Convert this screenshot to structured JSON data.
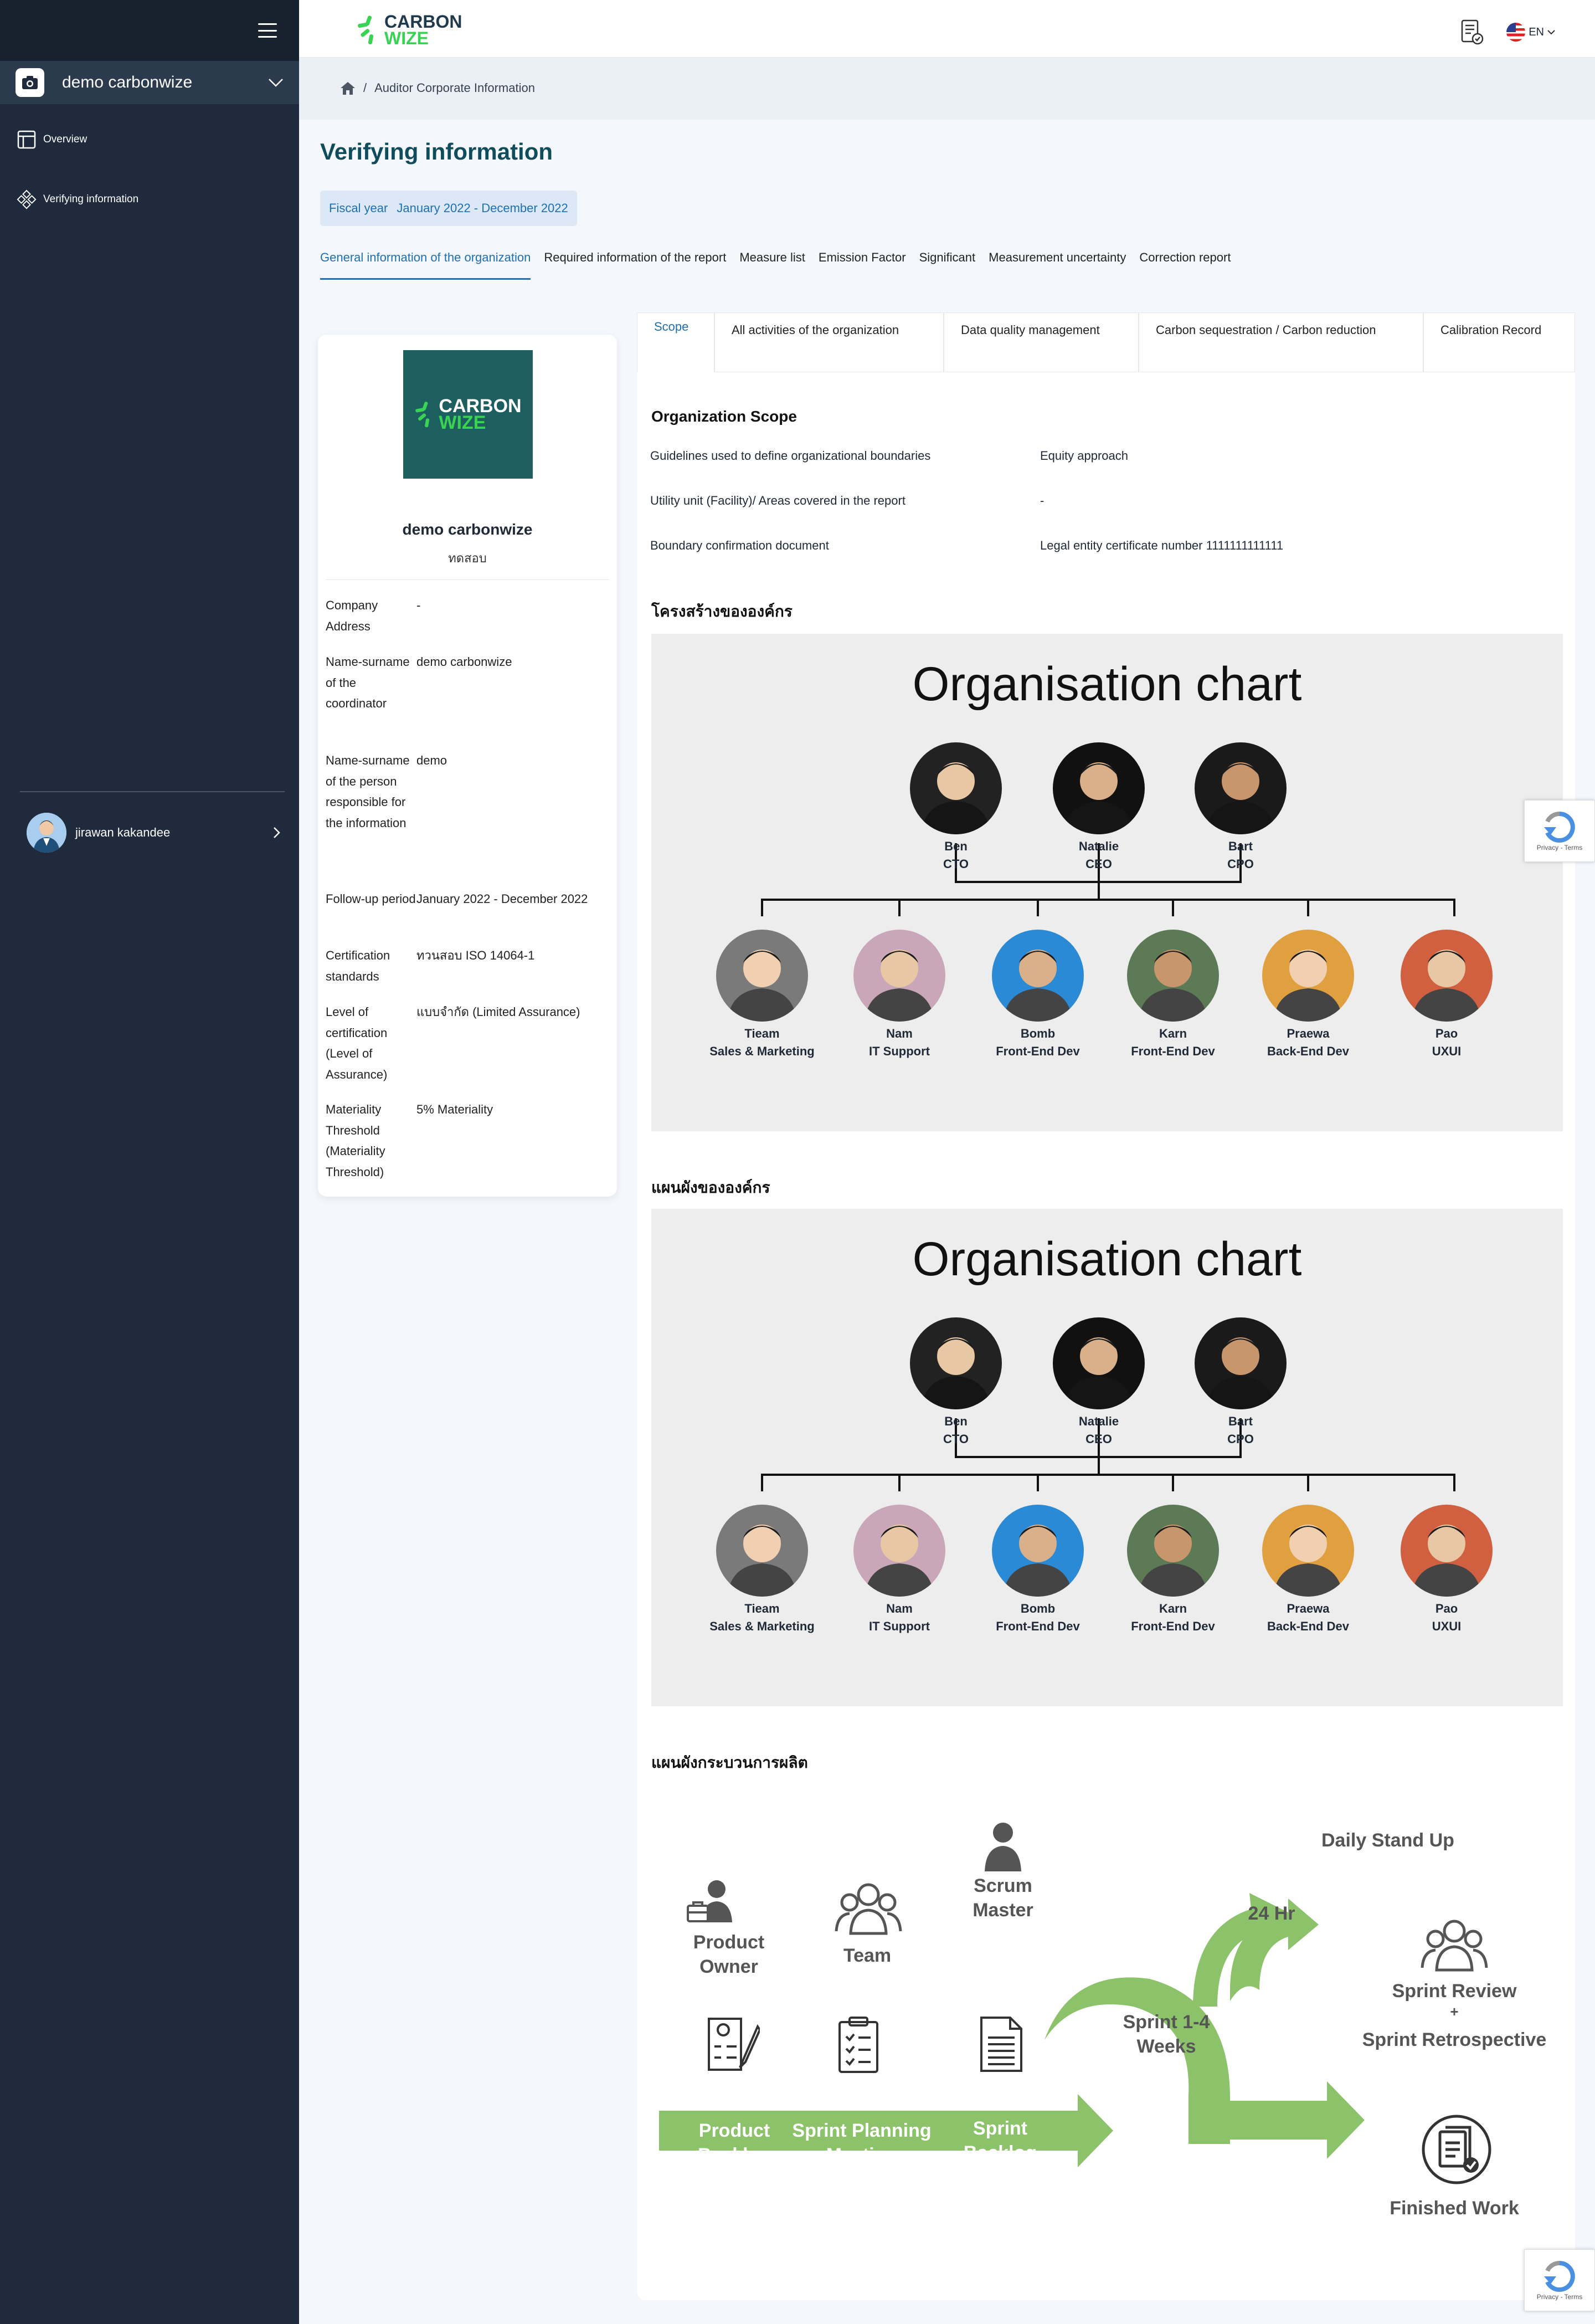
{
  "sidebar": {
    "org_name": "demo carbonwize",
    "items": [
      {
        "label": "Overview"
      },
      {
        "label": "Verifying information"
      }
    ],
    "user_name": "jirawan kakandee"
  },
  "topbar": {
    "logo_line1": "CARBON",
    "logo_line2": "WIZE",
    "lang": "EN"
  },
  "breadcrumb": {
    "current": "Auditor Corporate Information"
  },
  "page": {
    "title": "Verifying information",
    "fiscal_label": "Fiscal year",
    "fiscal_value": "January 2022 - December 2022"
  },
  "tabs": [
    {
      "label": "General information of the organization"
    },
    {
      "label": "Required information of the report"
    },
    {
      "label": "Measure list"
    },
    {
      "label": "Emission Factor"
    },
    {
      "label": "Significant"
    },
    {
      "label": "Measurement uncertainty"
    },
    {
      "label": "Correction report"
    }
  ],
  "company": {
    "logo_line1": "CARBON",
    "logo_line2": "WIZE",
    "name": "demo carbonwize",
    "sub": "ทดสอบ",
    "rows": [
      {
        "k": "Company Address",
        "v": "-"
      },
      {
        "k": "Name-surname of the coordinator",
        "v": "demo carbonwize"
      },
      {
        "k": "Name-surname of the person responsible for the information",
        "v": "demo"
      },
      {
        "k": "Follow-up period",
        "v": "January 2022 - December 2022"
      },
      {
        "k": "Certification standards",
        "v": "ทวนสอบ ISO 14064-1"
      },
      {
        "k": "Level of certification (Level of Assurance)",
        "v": "แบบจำกัด (Limited Assurance)"
      },
      {
        "k": "Materiality Threshold (Materiality Threshold)",
        "v": "5% Materiality"
      }
    ]
  },
  "subtabs": [
    {
      "label": "Scope"
    },
    {
      "label": "All activities of the organization"
    },
    {
      "label": "Data quality management"
    },
    {
      "label": "Carbon sequestration / Carbon reduction"
    },
    {
      "label": "Calibration Record"
    }
  ],
  "scope": {
    "title": "Organization Scope",
    "rows": [
      {
        "k": "Guidelines used to define organizational boundaries",
        "v": "Equity approach"
      },
      {
        "k": "Utility unit (Facility)/ Areas covered in the report",
        "v": "-"
      },
      {
        "k": "Boundary confirmation document",
        "v": "Legal entity certificate number 1111111111111"
      }
    ]
  },
  "org_structure_title": "โครงสร้างขององค์กร",
  "org_chart_title": "แผนผังขององค์กร",
  "process_title": "แผนผังกระบวนการผลิต",
  "chart": {
    "heading": "Organisation chart",
    "top": [
      {
        "name": "Ben",
        "role": "CTO"
      },
      {
        "name": "Natalie",
        "role": "CEO"
      },
      {
        "name": "Bart",
        "role": "CPO"
      }
    ],
    "bottom": [
      {
        "name": "Tieam",
        "role": "Sales & Marketing"
      },
      {
        "name": "Nam",
        "role": "IT Support"
      },
      {
        "name": "Bomb",
        "role": "Front-End Dev"
      },
      {
        "name": "Karn",
        "role": "Front-End Dev"
      },
      {
        "name": "Praewa",
        "role": "Back-End Dev"
      },
      {
        "name": "Pao",
        "role": "UXUI"
      }
    ]
  },
  "process": {
    "product_owner": "Product Owner",
    "team": "Team",
    "scrum_master": "Scrum Master",
    "daily": "Daily Stand Up",
    "hr": "24 Hr",
    "sprint": "Sprint 1-4 Weeks",
    "review": "Sprint Review",
    "plus": "+",
    "retro": "Sprint Retrospective",
    "backlog": "Product Backlog",
    "planning": "Sprint Planning Meeting",
    "sprint_backlog": "Sprint Backlog",
    "finished": "Finished Work"
  },
  "recaptcha": {
    "text": "Privacy - Terms"
  }
}
